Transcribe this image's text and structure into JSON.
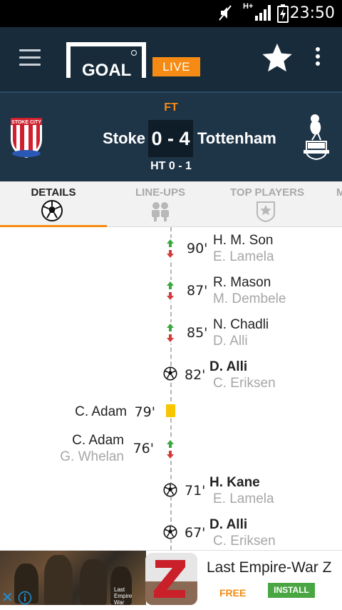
{
  "status_bar": {
    "time": "23:50",
    "network": "H+"
  },
  "app_bar": {
    "logo_text": "GOAL",
    "live_label": "LIVE"
  },
  "match": {
    "status": "FT",
    "home": "Stoke",
    "away": "Tottenham",
    "score": "0 - 4",
    "half_time": "HT 0 - 1",
    "home_crest_text": "STOKE CITY"
  },
  "tabs": [
    {
      "label": "DETAILS",
      "icon": "soccer-ball-icon",
      "active": true
    },
    {
      "label": "LINE-UPS",
      "icon": "players-icon",
      "active": false
    },
    {
      "label": "TOP PLAYERS",
      "icon": "badge-star-icon",
      "active": false
    },
    {
      "label": "M",
      "icon": "",
      "active": false
    }
  ],
  "events": [
    {
      "type": "substitution",
      "side": "away",
      "minute": "90'",
      "player_in": "H. M. Son",
      "player_out": "E. Lamela"
    },
    {
      "type": "substitution",
      "side": "away",
      "minute": "87'",
      "player_in": "R. Mason",
      "player_out": "M. Dembele"
    },
    {
      "type": "substitution",
      "side": "away",
      "minute": "85'",
      "player_in": "N. Chadli",
      "player_out": "D. Alli"
    },
    {
      "type": "goal",
      "side": "away",
      "minute": "82'",
      "scorer": "D. Alli",
      "assist": "C. Eriksen"
    },
    {
      "type": "yellow-card",
      "side": "home",
      "minute": "79'",
      "player": "C. Adam"
    },
    {
      "type": "substitution",
      "side": "home",
      "minute": "76'",
      "player_in": "C. Adam",
      "player_out": "G. Whelan"
    },
    {
      "type": "goal",
      "side": "away",
      "minute": "71'",
      "scorer": "H. Kane",
      "assist": "E. Lamela"
    },
    {
      "type": "goal",
      "side": "away",
      "minute": "67'",
      "scorer": "D. Alli",
      "assist": "C. Eriksen"
    }
  ],
  "ad": {
    "title": "Last Empire-War Z",
    "price": "FREE",
    "install_label": "INSTALL",
    "image_caption": "Last Empire War"
  },
  "colors": {
    "accent": "#f58b14",
    "header": "#182b3a",
    "scoreboard": "#1e3447",
    "sub_in": "#3aa83c",
    "sub_out": "#d43a3a",
    "yellow_card": "#f7c600",
    "install": "#4aa643"
  }
}
